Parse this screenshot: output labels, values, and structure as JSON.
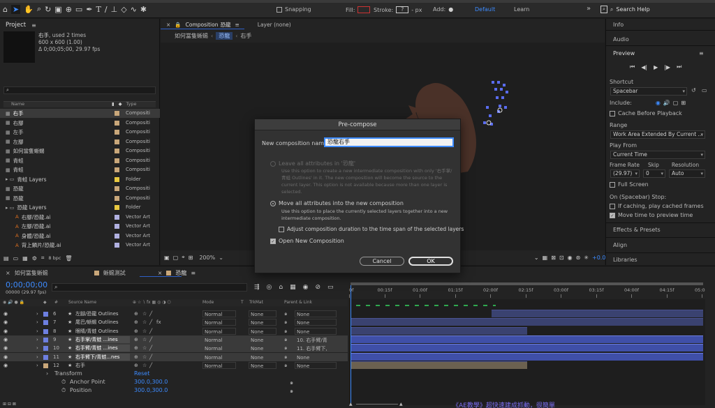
{
  "toolbar": {
    "snapping_label": "Snapping",
    "fill_label": "Fill:",
    "stroke_label": "Stroke:",
    "stroke_value": "?",
    "stroke_unit": "- px",
    "add_label": "Add:",
    "workspace_default": "Default",
    "workspace_learn": "Learn",
    "search_help": "Search Help"
  },
  "project": {
    "title": "Project",
    "selected_name": "右手",
    "used_times": ", used 2 times",
    "dimensions": "600 x 600 (1.00)",
    "duration": "Δ 0;00;05;00, 29.97 fps",
    "col_name": "Name",
    "col_type": "Type",
    "items": [
      {
        "name": "右手",
        "type": "Compositi",
        "color": "#c9a77a",
        "kind": "comp",
        "indent": 0,
        "selected": true
      },
      {
        "name": "右腳",
        "type": "Compositi",
        "color": "#c9a77a",
        "kind": "comp",
        "indent": 0
      },
      {
        "name": "左手",
        "type": "Compositi",
        "color": "#c9a77a",
        "kind": "comp",
        "indent": 0
      },
      {
        "name": "左腳",
        "type": "Compositi",
        "color": "#c9a77a",
        "kind": "comp",
        "indent": 0
      },
      {
        "name": "如何當隻蜥蜴",
        "type": "Compositi",
        "color": "#c9a77a",
        "kind": "comp",
        "indent": 0
      },
      {
        "name": "青蛙",
        "type": "Compositi",
        "color": "#c9a77a",
        "kind": "comp",
        "indent": 0
      },
      {
        "name": "青蛙",
        "type": "Compositi",
        "color": "#c9a77a",
        "kind": "comp",
        "indent": 0
      },
      {
        "name": "青蛙 Layers",
        "type": "Folder",
        "color": "#e8c840",
        "kind": "folder",
        "indent": 0
      },
      {
        "name": "恐龍",
        "type": "Compositi",
        "color": "#c9a77a",
        "kind": "comp",
        "indent": 0
      },
      {
        "name": "恐龍",
        "type": "Compositi",
        "color": "#c9a77a",
        "kind": "comp",
        "indent": 0
      },
      {
        "name": "恐龍 Layers",
        "type": "Folder",
        "color": "#e8c840",
        "kind": "folder",
        "indent": 0
      },
      {
        "name": "右腳/恐龍.ai",
        "type": "Vector Art",
        "color": "#b0b0e0",
        "kind": "ai",
        "indent": 1
      },
      {
        "name": "左腳/恐龍.ai",
        "type": "Vector Art",
        "color": "#b0b0e0",
        "kind": "ai",
        "indent": 1
      },
      {
        "name": "身體/恐龍.ai",
        "type": "Vector Art",
        "color": "#b0b0e0",
        "kind": "ai",
        "indent": 1
      },
      {
        "name": "背上鱗片/恐龍.ai",
        "type": "Vector Art",
        "color": "#b0b0e0",
        "kind": "ai",
        "indent": 1
      }
    ],
    "bpc": "8 bpc"
  },
  "composition": {
    "tab_label": "Composition",
    "tab_name": "恐龍",
    "layer_tab": "Layer (none)",
    "breadcrumbs": [
      "如何當隻蜥蜴",
      "恐龍",
      "右手"
    ],
    "zoom": "200%",
    "exposure": "+0.0"
  },
  "dialog": {
    "title": "Pre-compose",
    "name_label": "New composition name:",
    "name_value": "恐龍右手",
    "option1_label": "Leave all attributes in '恐龍'",
    "option1_desc": "Use this option to create a new intermediate composition with only '右手掌/青蛙 Outlines' in it. The new composition will become the source to the current layer. This option is not available because more than one layer is selected.",
    "option2_label": "Move all attributes into the new composition",
    "option2_desc": "Use this option to place the currently selected layers together into a new intermediate composition.",
    "adjust_label": "Adjust composition duration to the time span of the selected layers",
    "open_label": "Open New Composition",
    "cancel": "Cancel",
    "ok": "OK"
  },
  "right_panel": {
    "info": "Info",
    "audio": "Audio",
    "preview": "Preview",
    "shortcut_label": "Shortcut",
    "shortcut_value": "Spacebar",
    "include_label": "Include:",
    "cache_label": "Cache Before Playback",
    "range_label": "Range",
    "range_value": "Work Area Extended By Current ...",
    "play_from_label": "Play From",
    "play_from_value": "Current Time",
    "frame_rate_label": "Frame Rate",
    "skip_label": "Skip",
    "resolution_label": "Resolution",
    "frame_rate_value": "(29.97)",
    "skip_value": "0",
    "resolution_value": "Auto",
    "full_screen_label": "Full Screen",
    "on_stop_label": "On (Spacebar) Stop:",
    "if_caching_label": "If caching, play cached frames",
    "move_time_label": "Move time to preview time",
    "effects_presets": "Effects & Presets",
    "align": "Align",
    "libraries": "Libraries"
  },
  "timeline": {
    "tabs": [
      "如何當隻蜥蜴",
      "蜥蜴測試",
      "恐龍"
    ],
    "timecode": "0;00;00;00",
    "frame_info": "00000 (29.97 fps)",
    "col_source": "Source Name",
    "col_mode": "Mode",
    "col_t": "T",
    "col_trkmat": "TrkMat",
    "col_parent": "Parent & Link",
    "ruler": [
      "0f",
      "00:15f",
      "01:00f",
      "01:15f",
      "02:00f",
      "02:15f",
      "03:00f",
      "03:15f",
      "04:00f",
      "04:15f",
      "05:0"
    ],
    "layers": [
      {
        "num": "6",
        "name": "左腳/恐龍 Outlines",
        "color": "#6d7fe0",
        "mode": "Normal",
        "trkmat": "None",
        "parent": "None",
        "selected": false,
        "fx": false,
        "bar_start": 0.4,
        "bar_end": 1.0
      },
      {
        "num": "7",
        "name": "尾巴/蜥蜴 Outlines",
        "color": "#6d7fe0",
        "mode": "Normal",
        "trkmat": "None",
        "parent": "None",
        "selected": false,
        "fx": true,
        "bar_start": 0.0,
        "bar_end": 1.0
      },
      {
        "num": "8",
        "name": "眼睛/青蛙 Outlines",
        "color": "#6d7fe0",
        "mode": "Normal",
        "trkmat": "None",
        "parent": "None",
        "selected": false,
        "fx": false,
        "bar_start": 0.0,
        "bar_end": 0.5
      },
      {
        "num": "9",
        "name": "右手掌/青蛙 ...ines",
        "color": "#6d7fe0",
        "mode": "Normal",
        "trkmat": "None",
        "parent": "10. 右手臂/青",
        "selected": true,
        "fx": false,
        "bar_start": 0.0,
        "bar_end": 1.0
      },
      {
        "num": "10",
        "name": "右手臂/青蛙 ...ines",
        "color": "#6d7fe0",
        "mode": "Normal",
        "trkmat": "None",
        "parent": "11. 右手臂下,",
        "selected": true,
        "fx": false,
        "bar_start": 0.0,
        "bar_end": 1.0
      },
      {
        "num": "11",
        "name": "右手臂下/青蛙...nes",
        "color": "#6d7fe0",
        "mode": "Normal",
        "trkmat": "None",
        "parent": "None",
        "selected": true,
        "fx": false,
        "bar_start": 0.0,
        "bar_end": 1.0
      },
      {
        "num": "12",
        "name": "右手",
        "color": "#c9a77a",
        "mode": "Normal",
        "trkmat": "None",
        "parent": "None",
        "selected": false,
        "fx": false,
        "bar_start": 0.0,
        "bar_end": 0.5
      }
    ],
    "transform_label": "Transform",
    "reset_label": "Reset",
    "anchor_label": "Anchor Point",
    "anchor_value": "300.0,300.0",
    "position_label": "Position",
    "position_value": "300.0,300.0"
  },
  "overlay_text": "《AE教學》超快速建成抓動，很簡單"
}
